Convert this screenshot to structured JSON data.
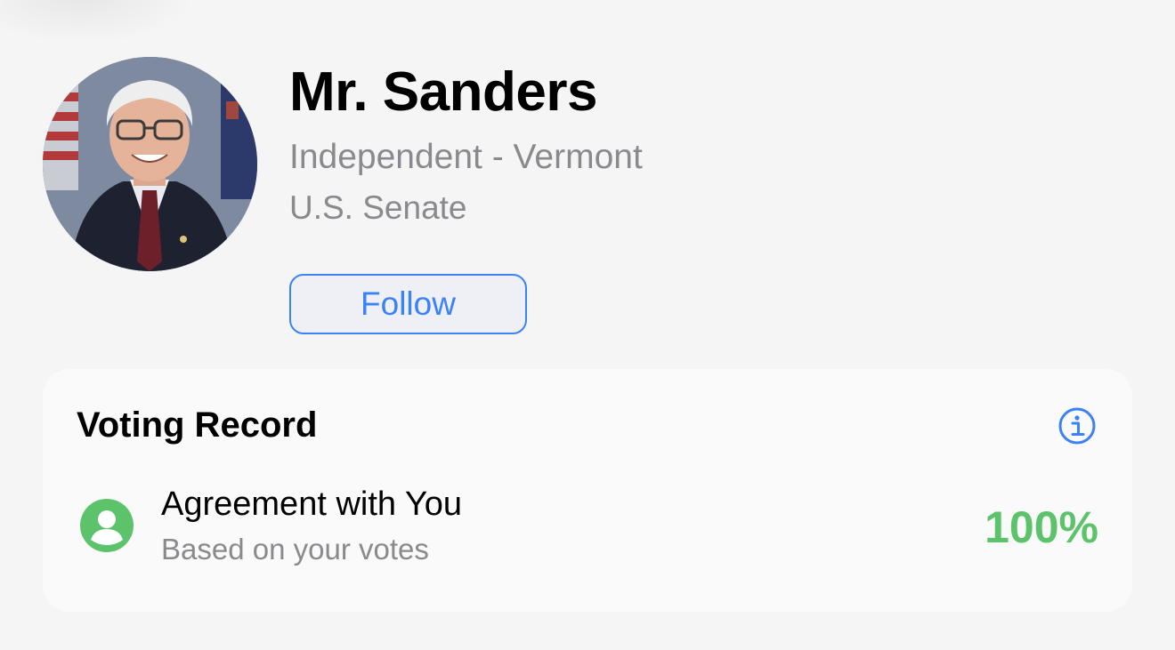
{
  "profile": {
    "name": "Mr. Sanders",
    "party_state": "Independent - Vermont",
    "chamber": "U.S. Senate",
    "follow_label": "Follow"
  },
  "voting_record": {
    "title": "Voting Record",
    "info_icon": "info-circle-icon",
    "agreement": {
      "icon": "person-circle-icon",
      "title": "Agreement with You",
      "subtitle": "Based on your votes",
      "value": "100%"
    }
  },
  "colors": {
    "accent_blue": "#3b82f6",
    "agreement_green": "#5cc36a",
    "secondary_text": "#8a8a8e"
  }
}
